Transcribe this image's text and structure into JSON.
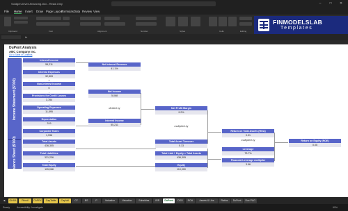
{
  "window": {
    "title": "Soldgen-Inven-financing.xlsx - Read-Only"
  },
  "menu": [
    "File",
    "Home",
    "Insert",
    "Draw",
    "Page Layout",
    "Formulas",
    "Data",
    "Review",
    "View"
  ],
  "ribbon_groups": [
    "Clipboard",
    "Font",
    "Alignment",
    "Number",
    "Styles",
    "Cells",
    "Editing"
  ],
  "sheet": {
    "title": "DuPont Analysis",
    "company": "ABC Company Inc.",
    "link": "Go to Table of Contents"
  },
  "side_labels": {
    "income": "Income Statement ($'000)",
    "balance": "Balance Sheet ($'000)"
  },
  "boxes": {
    "interest_income": {
      "label": "Interest Income",
      "value": "55,211"
    },
    "interest_expenses": {
      "label": "Interest Expenses",
      "value": "32,509"
    },
    "non_interest_income": {
      "label": "Non-Interest Income",
      "value": "0"
    },
    "provisions": {
      "label": "Provisions for Credit Losses",
      "value": "3,784"
    },
    "operating_expenses": {
      "label": "Operating Expenses",
      "value": "11,595"
    },
    "depreciation": {
      "label": "Depreciation",
      "value": "319"
    },
    "corporate_taxes": {
      "label": "Corporate Taxes",
      "value": "1,936"
    },
    "total_assets_left": {
      "label": "Total Assets",
      "value": "436,305"
    },
    "total_liabilities": {
      "label": "Total Liabilities",
      "value": "321,236"
    },
    "total_equity": {
      "label": "Total Equity",
      "value": "115,068"
    },
    "net_interest_revenue": {
      "label": "Net Interest Revenue",
      "value": "41.1%"
    },
    "net_income": {
      "label": "Net Income",
      "value": "5,068"
    },
    "interest_income_mid": {
      "label": "Interest Income",
      "value": "55,211"
    },
    "net_profit_margin": {
      "label": "Net Profit Margin",
      "value": "9.2%"
    },
    "total_asset_turnover": {
      "label": "Total Asset Turnover",
      "value": "0.13"
    },
    "total_liab_equity": {
      "label": "Total Liab + Equity = Total Assets",
      "value": "436,305"
    },
    "equity": {
      "label": "Equity",
      "value": "110,000"
    },
    "roa": {
      "label": "Return on Total Assets (ROA)",
      "value": "0.01"
    },
    "leverage": {
      "label": "Leverage",
      "value": "73.7%"
    },
    "flm": {
      "label": "Financial Leverage multiplier",
      "value": "3.96"
    },
    "roe": {
      "label": "Return on Equity (ROE)",
      "value": "0.05"
    }
  },
  "ops": {
    "minus": "-",
    "plus": "+",
    "divided_by": "divided by",
    "multiplied_by": "multiplied by"
  },
  "logo": {
    "line1": "FINMODELSLAB",
    "line2": "Templates"
  },
  "tabs": [
    "GHSA",
    "Pfinstl",
    "CAPEX",
    "CapTable",
    "CapVal",
    "CF",
    "BS",
    "P",
    "Valuation",
    "Valuation",
    "Subsidies",
    "IRR",
    "DuPont",
    "DSO",
    "ROA",
    "Assets & Libs",
    "Ratios",
    "DuPont",
    "Dox P&G"
  ],
  "active_tab": "DuPont",
  "status": {
    "left": "Ready",
    "accessibility": "Accessibility: Investigate",
    "zoom": "60%"
  }
}
